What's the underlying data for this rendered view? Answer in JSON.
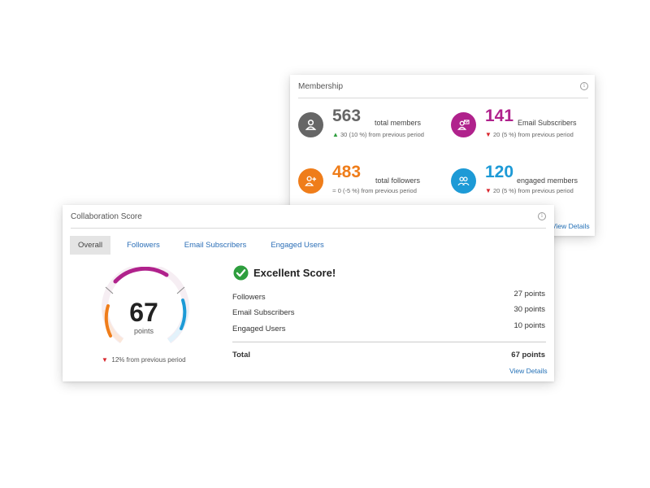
{
  "membership": {
    "title": "Membership",
    "info_icon": "ⓘ",
    "metrics": [
      {
        "value": "563",
        "label": "total members",
        "change_arrow": "▲",
        "change_text": "30 (10 %) from previous period",
        "color": "#666666",
        "icon": "person-icon"
      },
      {
        "value": "141",
        "label": "Email Subscribers",
        "change_arrow": "▼",
        "change_text": "20 (5 %) from previous period",
        "color": "#b0228c",
        "icon": "email-subscriber-icon"
      },
      {
        "value": "483",
        "label": "total followers",
        "change_arrow": "=",
        "change_text": "0 (-5 %) from previous period",
        "color": "#ef7d1a",
        "icon": "add-person-icon"
      },
      {
        "value": "120",
        "label": "engaged members",
        "change_arrow": "▼",
        "change_text": "20 (5 %) from previous period",
        "color": "#1d9ad6",
        "icon": "group-icon"
      }
    ],
    "view_details": "View Details"
  },
  "collab": {
    "title": "Collaboration Score",
    "info_icon": "ⓘ",
    "tabs": [
      "Overall",
      "Followers",
      "Email Subscribers",
      "Engaged Users"
    ],
    "active_tab": "Overall",
    "score": "67",
    "score_unit": "points",
    "score_change_arrow": "▼",
    "score_change": "12% from previous period",
    "status_title": "Excellent Score!",
    "rows": [
      {
        "label": "Followers",
        "points": "27 points"
      },
      {
        "label": "Email Subscribers",
        "points": "30 points"
      },
      {
        "label": "Engaged Users",
        "points": "10 points"
      }
    ],
    "total_label": "Total",
    "total_points": "67 points",
    "view_details": "View Details"
  },
  "colors": {
    "followers": "#ef7d1a",
    "email_subscribers": "#b0228c",
    "engaged_users": "#1d9ad6",
    "success": "#2e9e3e",
    "link": "#2471b7"
  }
}
